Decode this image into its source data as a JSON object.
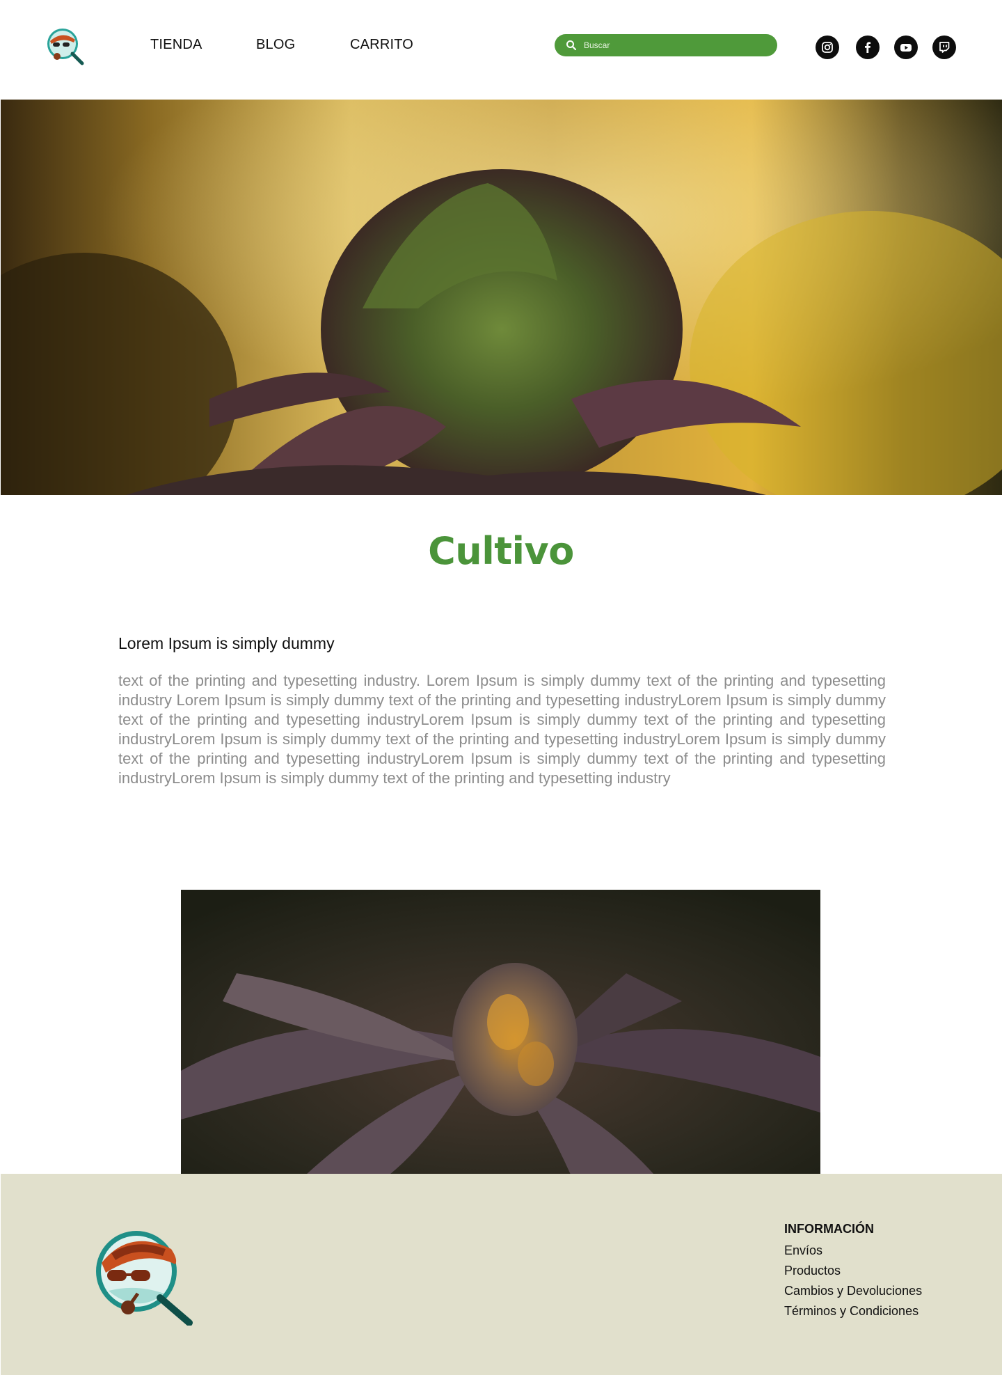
{
  "header": {
    "nav": [
      "TIENDA",
      "BLOG",
      "CARRITO"
    ],
    "search_placeholder": "Buscar",
    "social": [
      "instagram-icon",
      "facebook-icon",
      "youtube-icon",
      "twitch-icon"
    ]
  },
  "main": {
    "title": "Cultivo",
    "subtitle": "Lorem Ipsum is simply dummy",
    "body": " text of the printing and typesetting industry. Lorem Ipsum is simply dummy text of the printing and typesetting industry Lorem Ipsum is simply dummy text of the printing and typesetting industryLorem Ipsum is simply dummy text of the printing and typesetting industryLorem Ipsum is simply dummy text of the printing and typesetting industryLorem Ipsum is simply dummy text of the printing and typesetting industryLorem Ipsum is simply dummy text of the printing and typesetting industryLorem Ipsum is simply dummy text of the printing and typesetting industryLorem Ipsum is simply dummy text of the printing and typesetting industry"
  },
  "footer": {
    "heading": "INFORMACIÓN",
    "links": [
      "Envíos",
      "Productos",
      "Cambios y Devoluciones",
      "Términos y Condiciones"
    ]
  },
  "colors": {
    "accent": "#4b943a",
    "search_bg": "#4f9a3a",
    "footer_bg": "#e1e0cc"
  }
}
